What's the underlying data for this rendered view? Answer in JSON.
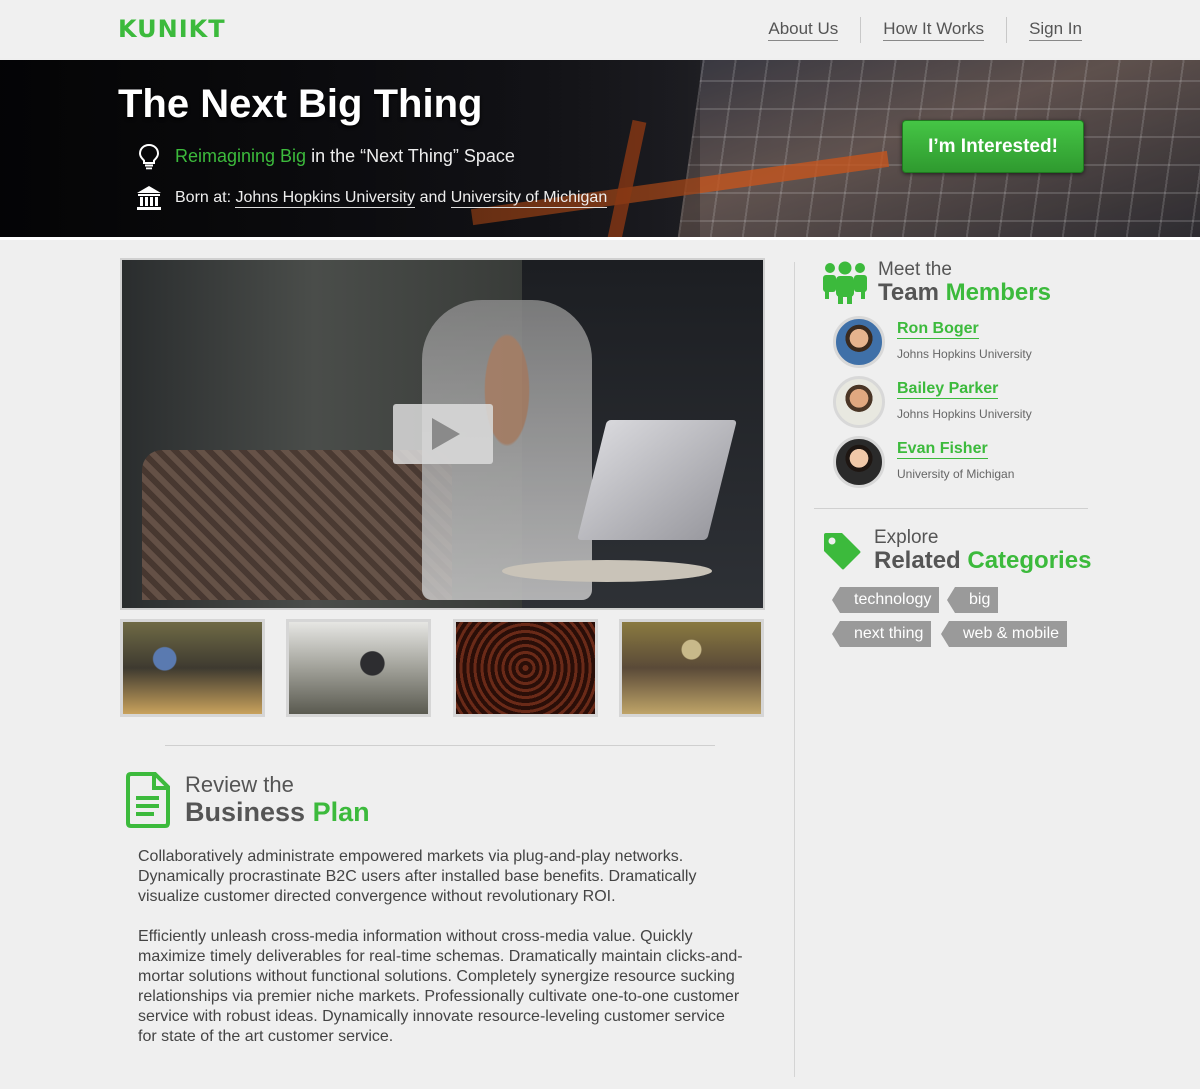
{
  "brand": {
    "logo": "KUNIKT"
  },
  "nav": {
    "about": "About Us",
    "how": "How It Works",
    "signin": "Sign In"
  },
  "hero": {
    "title": "The Next Big Thing",
    "tagline_highlight": "Reimagining Big",
    "tagline_rest": "in the “Next Thing” Space",
    "born_label": "Born at:",
    "school1": "Johns Hopkins University",
    "and": "and",
    "school2": "University of Michigan",
    "cta": "I’m Interested!"
  },
  "team": {
    "small": "Meet the",
    "big": "Team",
    "big_hl": "Members",
    "members": [
      {
        "name": "Ron Boger",
        "school": "Johns Hopkins University"
      },
      {
        "name": "Bailey Parker",
        "school": "Johns Hopkins University"
      },
      {
        "name": "Evan Fisher",
        "school": "University of Michigan"
      }
    ]
  },
  "categories": {
    "small": "Explore",
    "big": "Related",
    "big_hl": "Categories",
    "tags": [
      "technology",
      "big",
      "next thing",
      "web & mobile"
    ]
  },
  "plan": {
    "small": "Review the",
    "big": "Business",
    "big_hl": "Plan",
    "p1": "Collaboratively administrate empowered markets via plug-and-play networks. Dynamically procrastinate B2C users after installed base benefits. Dramatically visualize customer directed convergence without revolutionary ROI.",
    "p2": "Efficiently unleash cross-media information without cross-media value. Quickly maximize timely deliverables for real-time schemas. Dramatically maintain clicks-and-mortar solutions without functional solutions. Completely synergize resource sucking relationships via premier niche markets. Professionally cultivate one-to-one customer service with robust ideas. Dynamically innovate resource-leveling customer service for state of the art customer service."
  },
  "colors": {
    "accent": "#3cba3c",
    "tag": "#9a9a9a"
  },
  "icons": [
    "lightbulb-icon",
    "university-icon",
    "team-icon",
    "tag-icon",
    "document-icon",
    "play-icon"
  ]
}
